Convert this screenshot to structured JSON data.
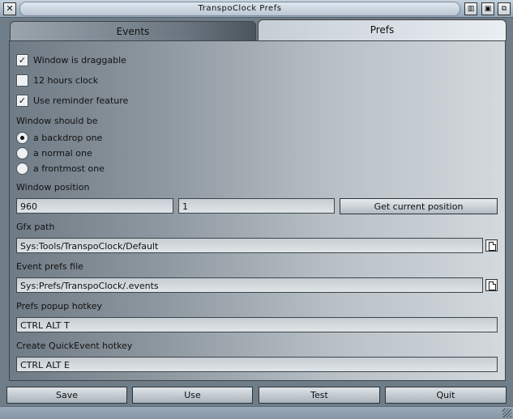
{
  "window": {
    "title": "TranspoClock Prefs",
    "close_glyph": "✕",
    "depth_glyph": "⧉",
    "zoom_glyph": "▣",
    "iconify_glyph": "▥"
  },
  "tabs": [
    {
      "label": "Events",
      "active": false
    },
    {
      "label": "Prefs",
      "active": true
    }
  ],
  "prefs": {
    "checkboxes": [
      {
        "label": "Window is draggable",
        "checked": true
      },
      {
        "label": "12 hours clock",
        "checked": false
      },
      {
        "label": "Use reminder feature",
        "checked": true
      }
    ],
    "window_should_be_label": "Window should be",
    "radios": [
      {
        "label": "a backdrop one",
        "selected": true
      },
      {
        "label": "a normal one",
        "selected": false
      },
      {
        "label": "a frontmost one",
        "selected": false
      }
    ],
    "window_position_label": "Window position",
    "position_x": "960",
    "position_y": "1",
    "get_position_label": "Get current position",
    "gfx_path_label": "Gfx path",
    "gfx_path": "Sys:Tools/TranspoClock/Default",
    "event_prefs_label": "Event prefs file",
    "event_prefs_path": "Sys:Prefs/TranspoClock/.events",
    "popup_hotkey_label": "Prefs popup hotkey",
    "popup_hotkey": "CTRL ALT T",
    "quickevent_hotkey_label": "Create QuickEvent hotkey",
    "quickevent_hotkey": "CTRL ALT E"
  },
  "buttons": {
    "save": "Save",
    "use": "Use",
    "test": "Test",
    "quit": "Quit"
  },
  "check_glyph": "✓"
}
